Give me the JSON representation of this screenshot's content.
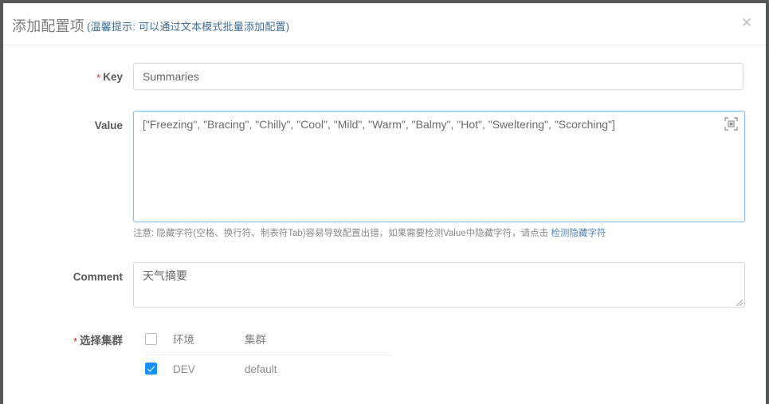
{
  "window": {
    "frame_color": "#555759",
    "background": "#ffffff"
  },
  "modal": {
    "title": "添加配置项",
    "title_tip": "(温馨提示: 可以通过文本模式批量添加配置)",
    "close_label": "✕"
  },
  "form": {
    "key": {
      "label": "Key",
      "required": true,
      "required_mark": "*",
      "value": "Summaries",
      "placeholder": "请输入Key"
    },
    "value": {
      "label": "Value",
      "required": false,
      "value": "[\"Freezing\", \"Bracing\", \"Chilly\", \"Cool\", \"Mild\", \"Warm\", \"Balmy\", \"Hot\", \"Sweltering\", \"Scorching\"]",
      "placeholder": "请输入Value",
      "fullscreen_icon": "fullscreen-expand-icon",
      "hint_prefix": "注意: 隐藏字符(空格、换行符、制表符Tab)容易导致配置出错，如果需要检测Value中隐藏字符，请点击",
      "hint_link": "检测隐藏字符"
    },
    "comment": {
      "label": "Comment",
      "required": false,
      "value": "天气摘要",
      "placeholder": "请输入备注"
    },
    "cluster": {
      "label": "选择集群",
      "required": true,
      "required_mark": "*",
      "columns": [
        "环境",
        "集群"
      ],
      "header_checkbox_checked": false,
      "rows": [
        {
          "checked": true,
          "env": "DEV",
          "cluster": "default"
        }
      ]
    }
  },
  "colors": {
    "accent": "#1890ff",
    "link": "#4a86b8",
    "required": "#f5222d",
    "border": "#d9d9d9",
    "focus_border": "#87bdf0",
    "title": "#7d7d7d",
    "tip": "#3f6f94"
  }
}
